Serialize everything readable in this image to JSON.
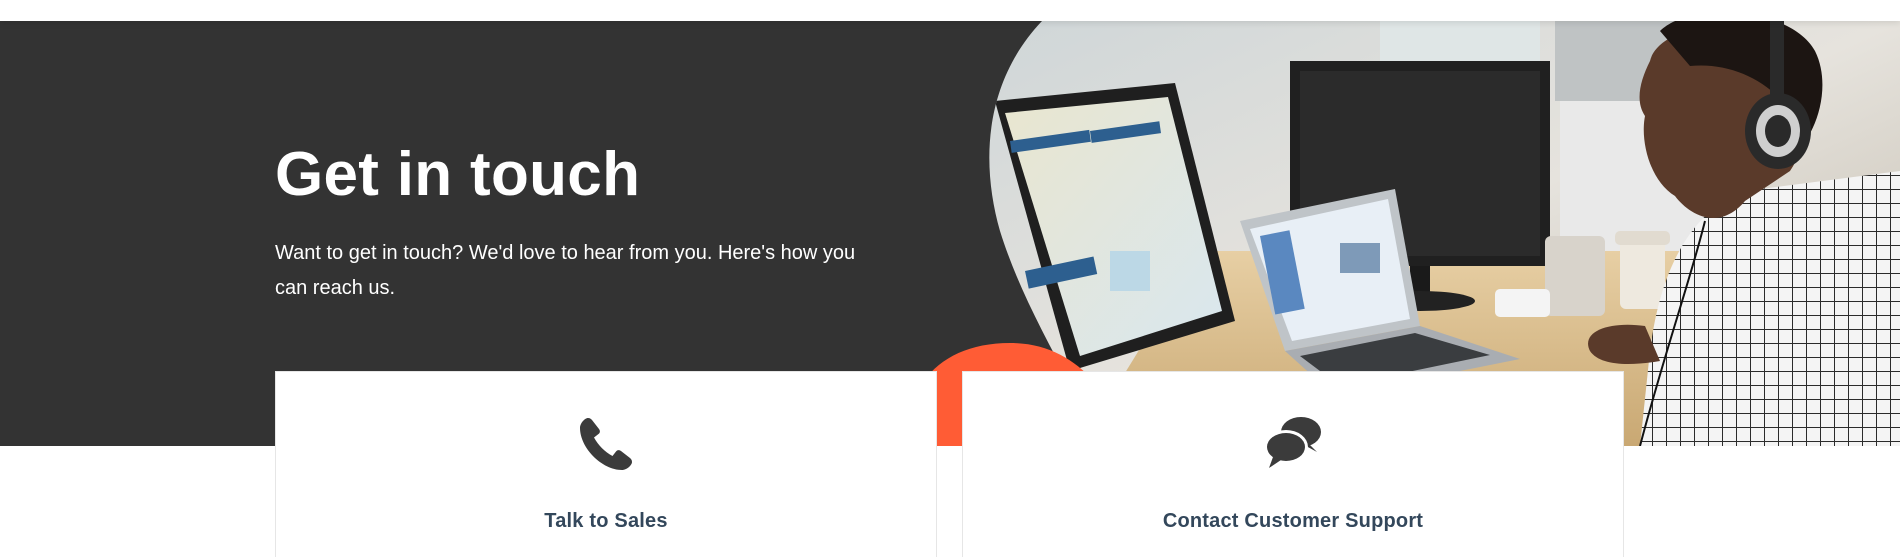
{
  "hero": {
    "title": "Get in touch",
    "subtitle": "Want to get in touch? We'd love to hear from you. Here's how you can reach us.",
    "background_color": "#333333",
    "accent_color": "#ff5c35",
    "photo_icon": "support-agent-photo"
  },
  "cards": [
    {
      "icon": "phone-icon",
      "title": "Talk to Sales"
    },
    {
      "icon": "chat-bubbles-icon",
      "title": "Contact Customer Support"
    }
  ],
  "colors": {
    "card_title": "#33475b",
    "icon": "#3b3b3b"
  }
}
